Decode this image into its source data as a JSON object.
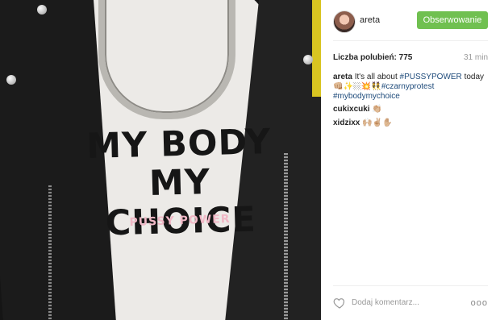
{
  "post": {
    "username": "areta",
    "follow_label": "Obserwowanie",
    "likes_text": "Liczba polubień: 775",
    "time_ago": "31 min",
    "caption_user": "areta",
    "caption_pre": "It's all about",
    "caption_tag1": "#PUSSYPOWER",
    "caption_mid": "today",
    "caption_emojis": "👊🏼✨🏼💥👯",
    "caption_tag2": "#czarnyprotest",
    "caption_tag3": "#mybodymychoice",
    "comments": [
      {
        "user": "cukixcuki",
        "text": "👏🏼"
      },
      {
        "user": "xidzixx",
        "text": "🙌🏼✌🏼✋🏼"
      }
    ],
    "add_comment_placeholder": "Dodaj komentarz...",
    "more_label": "ooo"
  },
  "photo": {
    "shirt_line1": "MY BODY",
    "shirt_line2": "MY CHOICE",
    "shirt_sub": "PUSSY POWER"
  },
  "colors": {
    "follow_bg": "#70c050",
    "hashtag": "#1d4a7a"
  }
}
